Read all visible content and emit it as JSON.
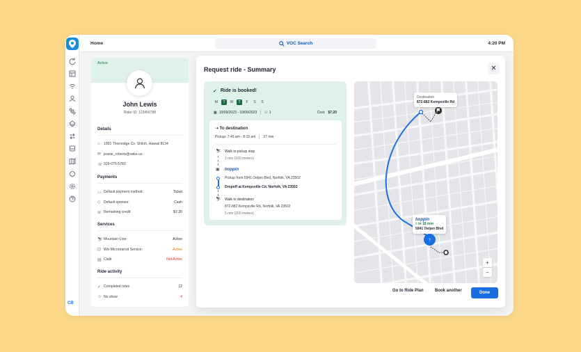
{
  "topbar": {
    "home": "Home",
    "search": "VOC Search",
    "time": "4:20 PM"
  },
  "rail": {
    "user_initials": "CB"
  },
  "profile": {
    "status": "Active",
    "name": "John Lewis",
    "rider_id": "Rider ID: 123456788",
    "details_title": "Details",
    "address": "1901 Thornridge Cir. Shiloh, Hawaii 8134",
    "email": "jeanie_roberts@ratke.us",
    "phone": "929-076-5783",
    "payments_title": "Payments",
    "payments": [
      {
        "label": "Default payment method:",
        "value": "Ticket"
      },
      {
        "label": "Default sponsor:",
        "value": "Cash"
      },
      {
        "label": "Remaining credit:",
        "value": "$7.20"
      }
    ],
    "services_title": "Services",
    "services": [
      {
        "label": "Mountain-Line:",
        "value": "Active",
        "color": "#1d7a4a"
      },
      {
        "label": "Wix Microtransit Service:",
        "value": "Active",
        "color": "#d9780b"
      },
      {
        "label": "Clalit",
        "value": "Not Active",
        "color": "#d93025"
      }
    ],
    "activity_title": "Ride activity",
    "activity": [
      {
        "label": "Completed rides",
        "value": "12"
      },
      {
        "label": "No show",
        "value": "4"
      }
    ]
  },
  "modal": {
    "title": "Request ride - Summary",
    "booked": "Ride is booked!",
    "days": [
      "M",
      "T",
      "W",
      "T",
      "F",
      "S",
      "S"
    ],
    "active_days": [
      1,
      3
    ],
    "dates": "10/09/2023 - 10/09/2023",
    "passengers": "1",
    "cost_label": "Cost:",
    "cost": "$7.20",
    "to_destination": "To destination",
    "pickup": "Pickup: 7:45 am - 8:15 am",
    "duration": "27 min",
    "walk_to_pickup": "Walk to pickup stop",
    "walk_to_pickup_detail": "3 min (100 meters)",
    "operator": "hoppin",
    "pickup_from": "Pickup from 5941 Oetjen Blvd, Norfolk, VA 23502",
    "dropoff": "Dropoff at Kempsville Cir, Norfolk, VA 23502",
    "walk_to_dest": "Walk to destination",
    "walk_to_dest_address": "872-882 Kempsville Rd, Norfolk, VA 23502",
    "walk_to_dest_detail": "5 min (200 meters)",
    "go_to_ride_plan": "Go to Ride Plan",
    "book_another": "Book another",
    "done": "Done"
  },
  "map": {
    "dest_label": "Destination",
    "dest_address": "872-882 Kempsville Rd",
    "pickup_operator": "hoppin",
    "pickup_eta": "in 18 min",
    "pickup_address": "5941 Oetjen Blvd",
    "zoom_in": "+",
    "zoom_out": "−",
    "route_color": "#1a6fe0"
  }
}
